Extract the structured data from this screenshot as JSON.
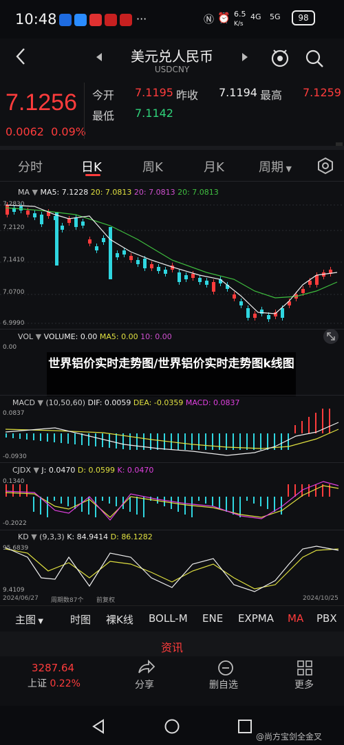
{
  "status": {
    "time": "10:48",
    "speed_top": "6.5",
    "speed_unit": "K/s",
    "net1": "4G",
    "net2": "5G",
    "battery": "98"
  },
  "header": {
    "title": "美元兑人民币",
    "subtitle": "USDCNY"
  },
  "quote": {
    "price": "7.1256",
    "change": "0.0062",
    "change_pct": "0.09%",
    "open_label": "今开",
    "open": "7.1195",
    "prev_label": "昨收",
    "prev": "7.1194",
    "high_label": "最高",
    "high": "7.1259",
    "low_label": "最低",
    "low": "7.1142"
  },
  "tabs": [
    "分时",
    "日K",
    "周K",
    "月K",
    "周期"
  ],
  "main_chart": {
    "label": "MA",
    "ma5": "MA5: 7.1228",
    "ma20a": "20: 7.0813",
    "ma20b": "20: 7.0813",
    "ma20c": "20: 7.0813",
    "y_ticks": [
      "7.2830",
      "7.2120",
      "7.1410",
      "7.0700",
      "6.9990"
    ]
  },
  "volume": {
    "label": "VOL",
    "values": "VOLUME: 0.00",
    "ma5": "MA5: 0.00",
    "ma10": "10: 0.00",
    "y0": "0.00"
  },
  "macd": {
    "label": "MACD",
    "params": "(10,50,60)",
    "dif": "DIF: 0.0059",
    "dea": "DEA: -0.0359",
    "macd": "MACD: 0.0837",
    "ytop": "0.0837",
    "ybot": "-0.0930"
  },
  "cjdx": {
    "label": "CJDX",
    "j": "J: 0.0470",
    "d": "D: 0.0599",
    "k": "K: 0.0470",
    "ytop": "0.1340",
    "ybot": "-0.2022"
  },
  "kd": {
    "label": "KD",
    "params": "(9,3,3)",
    "k": "K: 84.9414",
    "d": "D: 86.1282",
    "ytop": "95.6839",
    "ybot": "9.4109"
  },
  "xaxis": {
    "start": "2024/06/27",
    "mid1": "周期数87个",
    "mid2": "前复权",
    "end": "2024/10/25"
  },
  "overlay_text": "世界铝价实时走势图/世界铝价实时走势图k线图",
  "bottom_tabs": [
    "主图",
    "时图",
    "裸K线",
    "BOLL-M",
    "ENE",
    "EXPMA",
    "MA",
    "PBX"
  ],
  "news_label": "资讯",
  "bottom_nav": {
    "index_value": "3287.64",
    "index_name": "上证",
    "index_pct": "0.22%",
    "share": "分享",
    "delete": "删自选",
    "more": "更多"
  },
  "watermark": "@尚方宝剑全金叉",
  "colors": {
    "up": "#ff3c3c",
    "down": "#2fd6e0",
    "ma5": "#f0f0f0",
    "ma20": "#3fbf3f",
    "dea": "#e0e040",
    "macd_label": "#e040e0"
  }
}
